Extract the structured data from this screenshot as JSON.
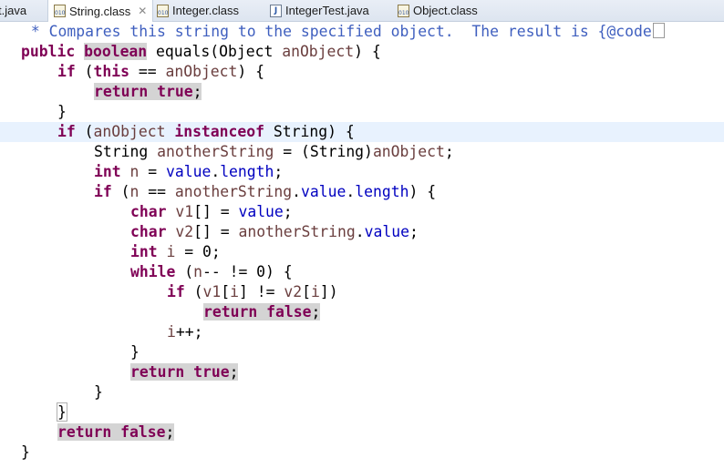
{
  "tabs": [
    {
      "label": "t.java",
      "icon": "java-file-icon",
      "active": false
    },
    {
      "label": "String.class",
      "icon": "class-file-icon",
      "active": true,
      "close_icon": "✕"
    },
    {
      "label": "Integer.class",
      "icon": "class-file-icon",
      "active": false
    },
    {
      "label": "IntegerTest.java",
      "icon": "java-file-icon",
      "active": false
    },
    {
      "label": "Object.class",
      "icon": "class-file-icon",
      "active": false
    }
  ],
  "colors": {
    "keyword": "#7f0055",
    "comment": "#3f5fbf",
    "field": "#0000c0",
    "local_variable": "#6a3e3e",
    "current_line": "#e8f2fe",
    "occurrence_highlight": "#d4d4d4"
  },
  "code": {
    "l1": {
      "comment": " * Compares this string to the specified object.  The result is {@code"
    },
    "l2": {
      "k1": "public",
      "k2": "boolean",
      "t1": " equals(Object ",
      "v1": "anObject",
      "t2": ") {"
    },
    "l3": {
      "k1": "if",
      "t1": " (",
      "k2": "this",
      "t2": " == ",
      "v1": "anObject",
      "t3": ") {"
    },
    "l4": {
      "k1": "return",
      "k2": "true",
      "t1": ";"
    },
    "l5": {
      "t1": "}"
    },
    "l6": {
      "k1": "if",
      "t1": " (",
      "v1": "anObject",
      "k2": "instanceof",
      "t2": " String) {"
    },
    "l7": {
      "t1": "String ",
      "v1": "anotherString",
      "t2": " = (String)",
      "v2": "anObject",
      "t3": ";"
    },
    "l8": {
      "k1": "int",
      "v1": "n",
      "t1": " = ",
      "f1": "value",
      "t2": ".",
      "f2": "length",
      "t3": ";"
    },
    "l9": {
      "k1": "if",
      "t1": " (",
      "v1": "n",
      "t2": " == ",
      "v2": "anotherString",
      "t3": ".",
      "f1": "value",
      "t4": ".",
      "f2": "length",
      "t5": ") {"
    },
    "l10": {
      "k1": "char",
      "v1": "v1",
      "t1": "[] = ",
      "f1": "value",
      "t2": ";"
    },
    "l11": {
      "k1": "char",
      "v1": "v2",
      "t1": "[] = ",
      "v2": "anotherString",
      "t2": ".",
      "f1": "value",
      "t3": ";"
    },
    "l12": {
      "k1": "int",
      "v1": "i",
      "t1": " = 0;"
    },
    "l13": {
      "k1": "while",
      "t1": " (",
      "v1": "n",
      "t2": "-- != 0) {"
    },
    "l14": {
      "k1": "if",
      "t1": " (",
      "v1": "v1",
      "t2": "[",
      "v2": "i",
      "t3": "] != ",
      "v3": "v2",
      "t4": "[",
      "v4": "i",
      "t5": "])"
    },
    "l15": {
      "k1": "return",
      "k2": "false",
      "t1": ";"
    },
    "l16": {
      "v1": "i",
      "t1": "++;"
    },
    "l17": {
      "t1": "}"
    },
    "l18": {
      "k1": "return",
      "k2": "true",
      "t1": ";"
    },
    "l19": {
      "t1": "}"
    },
    "l20": {
      "t1": "}"
    },
    "l21": {
      "k1": "return",
      "k2": "false",
      "t1": ";"
    },
    "l22": {
      "t1": "}"
    }
  }
}
